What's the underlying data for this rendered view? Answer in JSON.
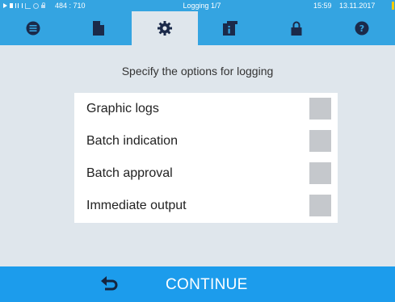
{
  "status": {
    "coords": "484 : 710",
    "title": "Logging 1/7",
    "time": "15:59",
    "date": "13.11.2017"
  },
  "tabs": [
    {
      "icon": "list-icon",
      "active": false
    },
    {
      "icon": "document-icon",
      "active": false
    },
    {
      "icon": "gear-icon",
      "active": true
    },
    {
      "icon": "info-document-icon",
      "active": false
    },
    {
      "icon": "lock-icon",
      "active": false
    },
    {
      "icon": "help-icon",
      "active": false
    }
  ],
  "instruction": "Specify the options for logging",
  "options": [
    {
      "label": "Graphic logs",
      "checked": false
    },
    {
      "label": "Batch indication",
      "checked": false
    },
    {
      "label": "Batch approval",
      "checked": false
    },
    {
      "label": "Immediate output",
      "checked": false
    }
  ],
  "footer": {
    "back_icon": "return-arrow-icon",
    "continue_label": "CONTINUE"
  },
  "colors": {
    "header_blue": "#34a4e1",
    "footer_blue": "#1c9cec",
    "background": "#dfe6ec",
    "checkbox": "#c5c8cc",
    "icon_navy": "#1b2a4a"
  }
}
